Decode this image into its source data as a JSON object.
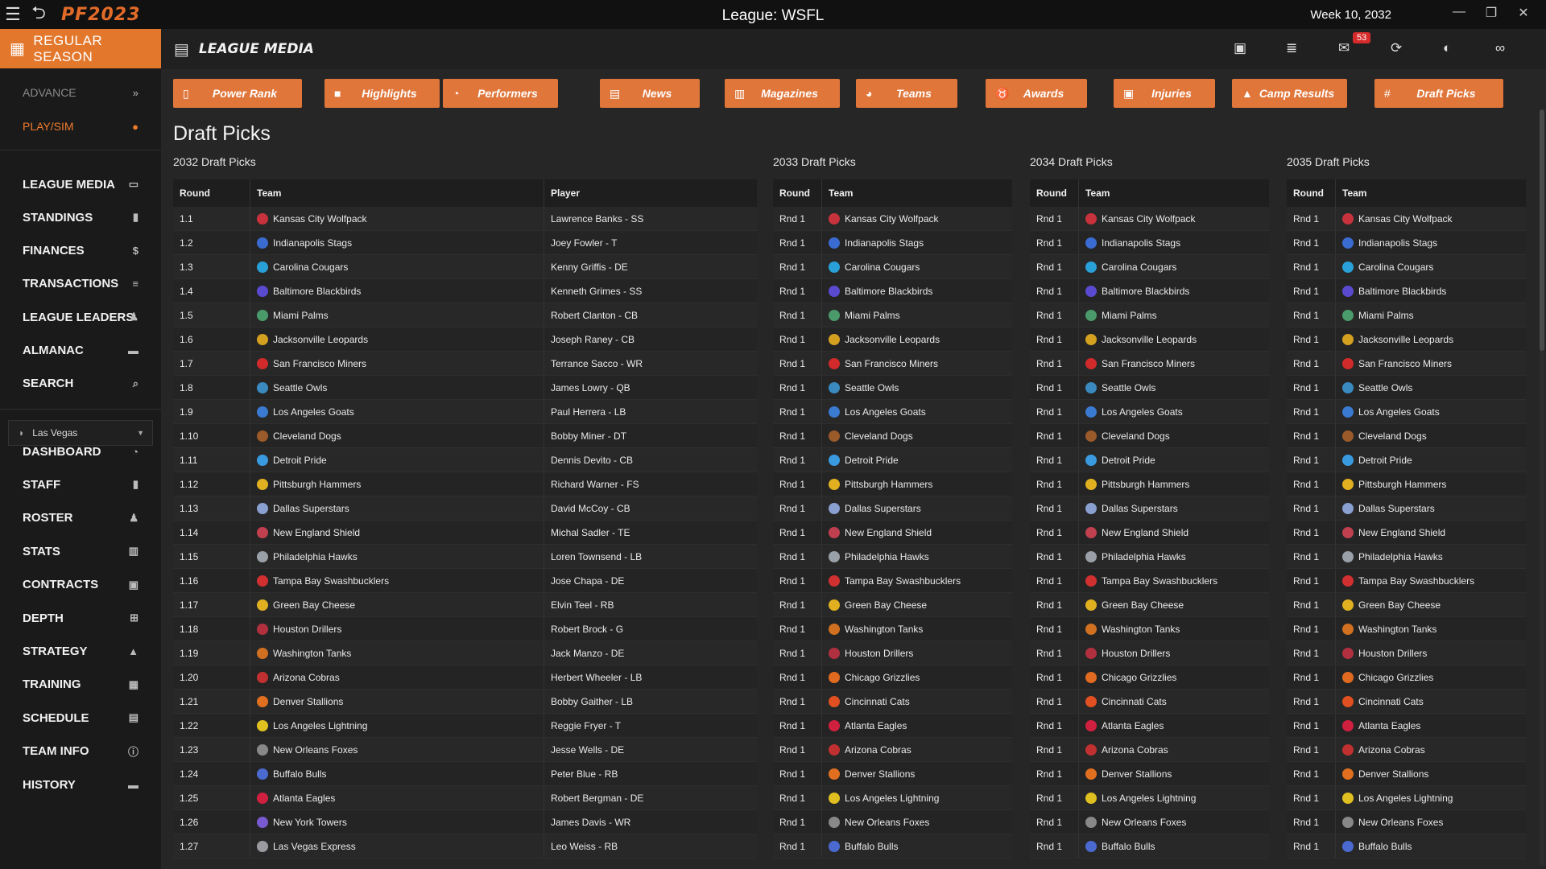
{
  "window": {
    "title": "League: WSFL",
    "week": "Week 10, 2032",
    "logo": "PF2023"
  },
  "sidebar": {
    "season_button": "REGULAR SEASON",
    "advance": "ADVANCE",
    "play_sim": "PLAY/SIM",
    "league_items": [
      "LEAGUE MEDIA",
      "STANDINGS",
      "FINANCES",
      "TRANSACTIONS",
      "LEAGUE LEADERS",
      "ALMANAC",
      "SEARCH"
    ],
    "team_select": "Las Vegas",
    "team_items": [
      "DASHBOARD",
      "STAFF",
      "ROSTER",
      "STATS",
      "CONTRACTS",
      "DEPTH",
      "STRATEGY",
      "TRAINING",
      "SCHEDULE",
      "TEAM INFO",
      "HISTORY"
    ]
  },
  "header": {
    "title": "LEAGUE MEDIA",
    "mail_count": "53"
  },
  "tabs": [
    "Power Rank",
    "Highlights",
    "Performers",
    "News",
    "Magazines",
    "Teams",
    "Awards",
    "Injuries",
    "Camp Results",
    "Draft Picks"
  ],
  "page_title": "Draft Picks",
  "table_2032": {
    "title": "2032 Draft Picks",
    "headers": [
      "Round",
      "Team",
      "Player"
    ],
    "rows": [
      [
        "1.1",
        "Kansas City Wolfpack",
        "Lawrence Banks - SS"
      ],
      [
        "1.2",
        "Indianapolis Stags",
        "Joey Fowler - T"
      ],
      [
        "1.3",
        "Carolina Cougars",
        "Kenny Griffis - DE"
      ],
      [
        "1.4",
        "Baltimore Blackbirds",
        "Kenneth Grimes - SS"
      ],
      [
        "1.5",
        "Miami Palms",
        "Robert Clanton - CB"
      ],
      [
        "1.6",
        "Jacksonville Leopards",
        "Joseph Raney - CB"
      ],
      [
        "1.7",
        "San Francisco Miners",
        "Terrance Sacco - WR"
      ],
      [
        "1.8",
        "Seattle Owls",
        "James Lowry - QB"
      ],
      [
        "1.9",
        "Los Angeles Goats",
        "Paul Herrera - LB"
      ],
      [
        "1.10",
        "Cleveland Dogs",
        "Bobby Miner - DT"
      ],
      [
        "1.11",
        "Detroit Pride",
        "Dennis Devito - CB"
      ],
      [
        "1.12",
        "Pittsburgh Hammers",
        "Richard Warner - FS"
      ],
      [
        "1.13",
        "Dallas Superstars",
        "David McCoy - CB"
      ],
      [
        "1.14",
        "New England Shield",
        "Michal Sadler - TE"
      ],
      [
        "1.15",
        "Philadelphia Hawks",
        "Loren Townsend - LB"
      ],
      [
        "1.16",
        "Tampa Bay Swashbucklers",
        "Jose Chapa - DE"
      ],
      [
        "1.17",
        "Green Bay Cheese",
        "Elvin Teel - RB"
      ],
      [
        "1.18",
        "Houston Drillers",
        "Robert Brock - G"
      ],
      [
        "1.19",
        "Washington Tanks",
        "Jack Manzo - DE"
      ],
      [
        "1.20",
        "Arizona Cobras",
        "Herbert Wheeler - LB"
      ],
      [
        "1.21",
        "Denver Stallions",
        "Bobby Gaither - LB"
      ],
      [
        "1.22",
        "Los Angeles Lightning",
        "Reggie Fryer - T"
      ],
      [
        "1.23",
        "New Orleans Foxes",
        "Jesse Wells - DE"
      ],
      [
        "1.24",
        "Buffalo Bulls",
        "Peter Blue - RB"
      ],
      [
        "1.25",
        "Atlanta Eagles",
        "Robert Bergman - DE"
      ],
      [
        "1.26",
        "New York Towers",
        "James Davis - WR"
      ],
      [
        "1.27",
        "Las Vegas Express",
        "Leo Weiss - RB"
      ]
    ]
  },
  "future_tables": [
    {
      "title": "2033 Draft Picks",
      "headers": [
        "Round",
        "Team"
      ]
    },
    {
      "title": "2034 Draft Picks",
      "headers": [
        "Round",
        "Team"
      ]
    },
    {
      "title": "2035 Draft Picks",
      "headers": [
        "Round",
        "Team"
      ]
    }
  ],
  "future_round_label": "Rnd 1",
  "future_teams": [
    "Kansas City Wolfpack",
    "Indianapolis Stags",
    "Carolina Cougars",
    "Baltimore Blackbirds",
    "Miami Palms",
    "Jacksonville Leopards",
    "San Francisco Miners",
    "Seattle Owls",
    "Los Angeles Goats",
    "Cleveland Dogs",
    "Detroit Pride",
    "Pittsburgh Hammers",
    "Dallas Superstars",
    "New England Shield",
    "Philadelphia Hawks",
    "Tampa Bay Swashbucklers",
    "Green Bay Cheese",
    "Washington Tanks",
    "Houston Drillers",
    "Chicago Grizzlies",
    "Cincinnati Cats",
    "Atlanta Eagles",
    "Arizona Cobras",
    "Denver Stallions",
    "Los Angeles Lightning",
    "New Orleans Foxes",
    "Buffalo Bulls"
  ],
  "team_colors": {
    "Kansas City Wolfpack": "#c8323c",
    "Indianapolis Stags": "#3a6bd0",
    "Carolina Cougars": "#2aa0d8",
    "Baltimore Blackbirds": "#5a4ad0",
    "Miami Palms": "#4a9a6a",
    "Jacksonville Leopards": "#d4a020",
    "San Francisco Miners": "#d02a2a",
    "Seattle Owls": "#3a8ac0",
    "Los Angeles Goats": "#3a7ad0",
    "Cleveland Dogs": "#9a5a2a",
    "Detroit Pride": "#3a9ae0",
    "Pittsburgh Hammers": "#e0b020",
    "Dallas Superstars": "#8aa0d0",
    "New England Shield": "#c04050",
    "Philadelphia Hawks": "#9aa0a8",
    "Tampa Bay Swashbucklers": "#d03030",
    "Green Bay Cheese": "#e0b020",
    "Houston Drillers": "#b03040",
    "Washington Tanks": "#d07020",
    "Arizona Cobras": "#c03030",
    "Denver Stallions": "#e07020",
    "Los Angeles Lightning": "#e0c020",
    "New Orleans Foxes": "#888888",
    "Buffalo Bulls": "#4a6ad0",
    "Atlanta Eagles": "#d02040",
    "New York Towers": "#7a5ad0",
    "Las Vegas Express": "#9a9aa0",
    "Chicago Grizzlies": "#e06a20",
    "Cincinnati Cats": "#e05020"
  }
}
